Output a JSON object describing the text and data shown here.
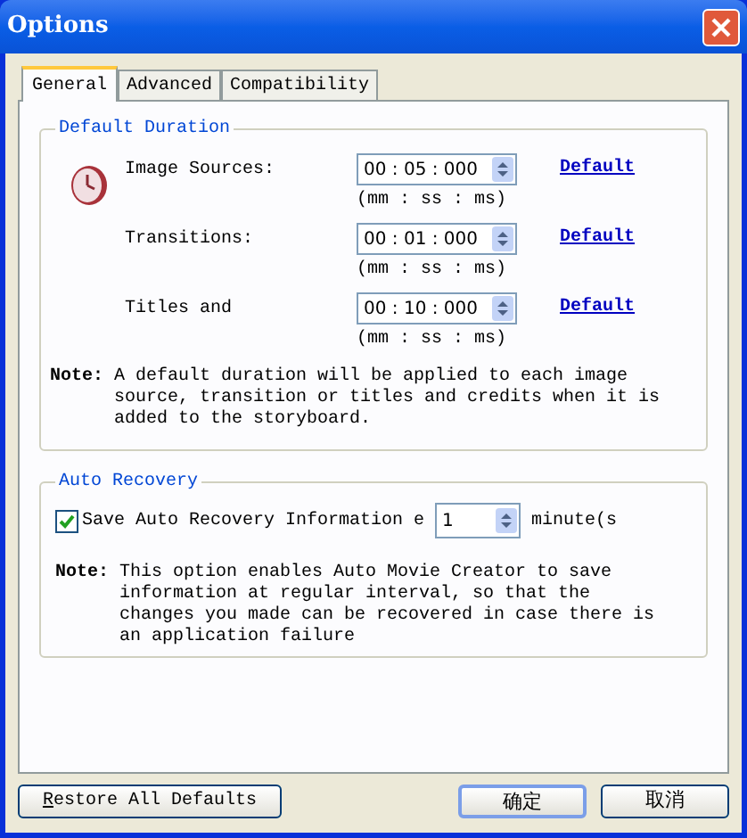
{
  "window": {
    "title": "Options"
  },
  "tabs": [
    {
      "label": "General",
      "selected": true
    },
    {
      "label": "Advanced",
      "selected": false
    },
    {
      "label": "Compatibility",
      "selected": false
    }
  ],
  "default_duration": {
    "title": "Default Duration",
    "rows": [
      {
        "label": "Image Sources:",
        "value": "00 : 05 : 000",
        "hint": "(mm : ss : ms)",
        "link": "Default"
      },
      {
        "label": "Transitions:",
        "value": "00 : 01 : 000",
        "hint": "(mm : ss : ms)",
        "link": "Default"
      },
      {
        "label": "Titles and",
        "value": "00 : 10 : 000",
        "hint": "(mm : ss : ms)",
        "link": "Default"
      }
    ],
    "note": {
      "label": "Note:",
      "text": "A default duration will be applied to each image source, transition or titles and credits when it is added to the storyboard."
    }
  },
  "auto_recovery": {
    "title": "Auto Recovery",
    "checkbox": {
      "label": "Save Auto Recovery Information e",
      "checked": true
    },
    "interval": "1",
    "unit": "minute(s",
    "note": {
      "label": "Note:",
      "text": "This option enables Auto Movie Creator to save information at regular interval, so that the changes you made can be recovered in case there is an application failure"
    }
  },
  "buttons": {
    "restore": "Restore All Defaults",
    "ok": "确定",
    "cancel": "取消"
  }
}
